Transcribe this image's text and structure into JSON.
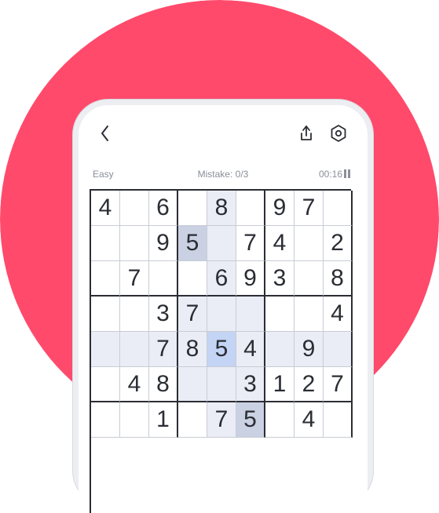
{
  "colors": {
    "circle_bg": "#ff4a6c",
    "selected_cell": "#c3d4f4",
    "same_number_cell": "#c9d1e2",
    "highlight_cell": "#eaedf5",
    "text": "#2b2d34",
    "status_text": "#8a8f99"
  },
  "header": {
    "back_icon": "chevron-left-icon",
    "share_icon": "share-icon",
    "settings_icon": "hexagon-settings-icon"
  },
  "status": {
    "difficulty": "Easy",
    "mistakes": "Mistake: 0/3",
    "timer": "00:16",
    "pause_icon": "pause-icon"
  },
  "board": {
    "cells": [
      [
        "4",
        "",
        "6",
        "",
        "8",
        "",
        "9",
        "7",
        ""
      ],
      [
        "",
        "",
        "9",
        "5",
        "",
        "7",
        "4",
        "",
        "2"
      ],
      [
        "",
        "7",
        "",
        "",
        "6",
        "9",
        "3",
        "",
        "8"
      ],
      [
        "",
        "",
        "3",
        "7",
        "",
        "",
        "",
        "",
        "4"
      ],
      [
        "",
        "",
        "7",
        "8",
        "5",
        "4",
        "",
        "9",
        ""
      ],
      [
        "",
        "4",
        "8",
        "",
        "",
        "3",
        "1",
        "2",
        "7"
      ],
      [
        "",
        "",
        "1",
        "",
        "7",
        "5",
        "",
        "4",
        ""
      ]
    ],
    "selected": {
      "row": 4,
      "col": 4
    },
    "selected_value": "5"
  }
}
